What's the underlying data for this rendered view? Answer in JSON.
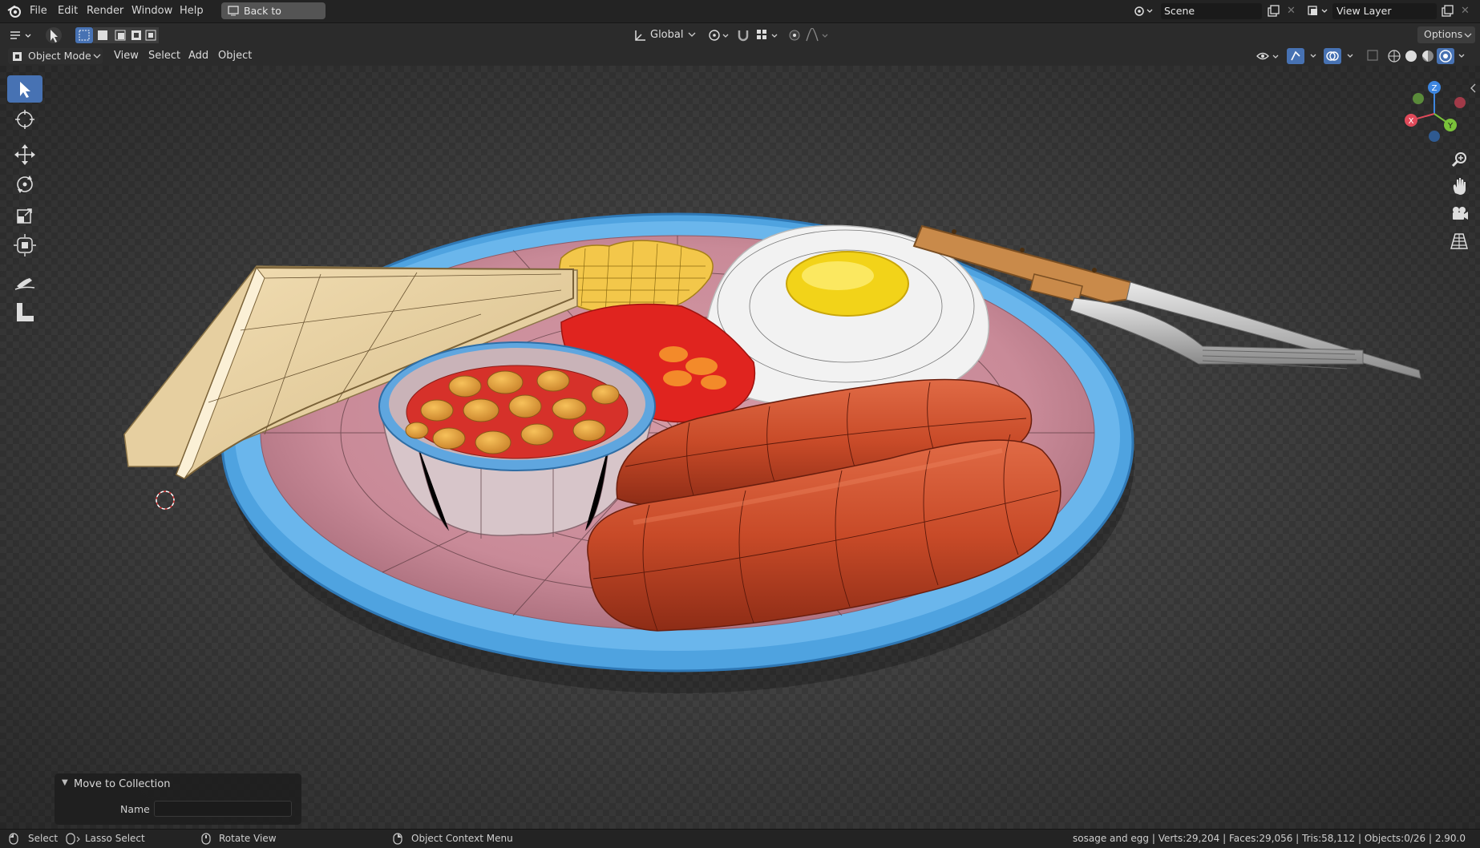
{
  "menu": {
    "file": "File",
    "edit": "Edit",
    "render": "Render",
    "window": "Window",
    "help": "Help",
    "back_to_previous": "Back to Previous",
    "scene": "Scene",
    "view_layer": "View Layer"
  },
  "toolbar": {
    "orientation": "Global",
    "options": "Options"
  },
  "header": {
    "mode": "Object Mode",
    "view": "View",
    "select": "Select",
    "add": "Add",
    "object": "Object"
  },
  "gizmo": {
    "x": "X",
    "y": "Y",
    "z": "Z"
  },
  "panel": {
    "title": "Move to Collection",
    "name_label": "Name",
    "name_value": ""
  },
  "status": {
    "select": "Select",
    "lasso": "Lasso Select",
    "rotate": "Rotate View",
    "context": "Object Context Menu",
    "stats": "sosage and egg | Verts:29,204 | Faces:29,056 | Tris:58,112 | Objects:0/26 | 2.90.0"
  },
  "colors": {
    "accent": "#4772b3",
    "plate_rim": "#4fa3e0",
    "plate_face": "#c98a98",
    "sausage": "#c94a2a",
    "yolk": "#f2d319"
  }
}
